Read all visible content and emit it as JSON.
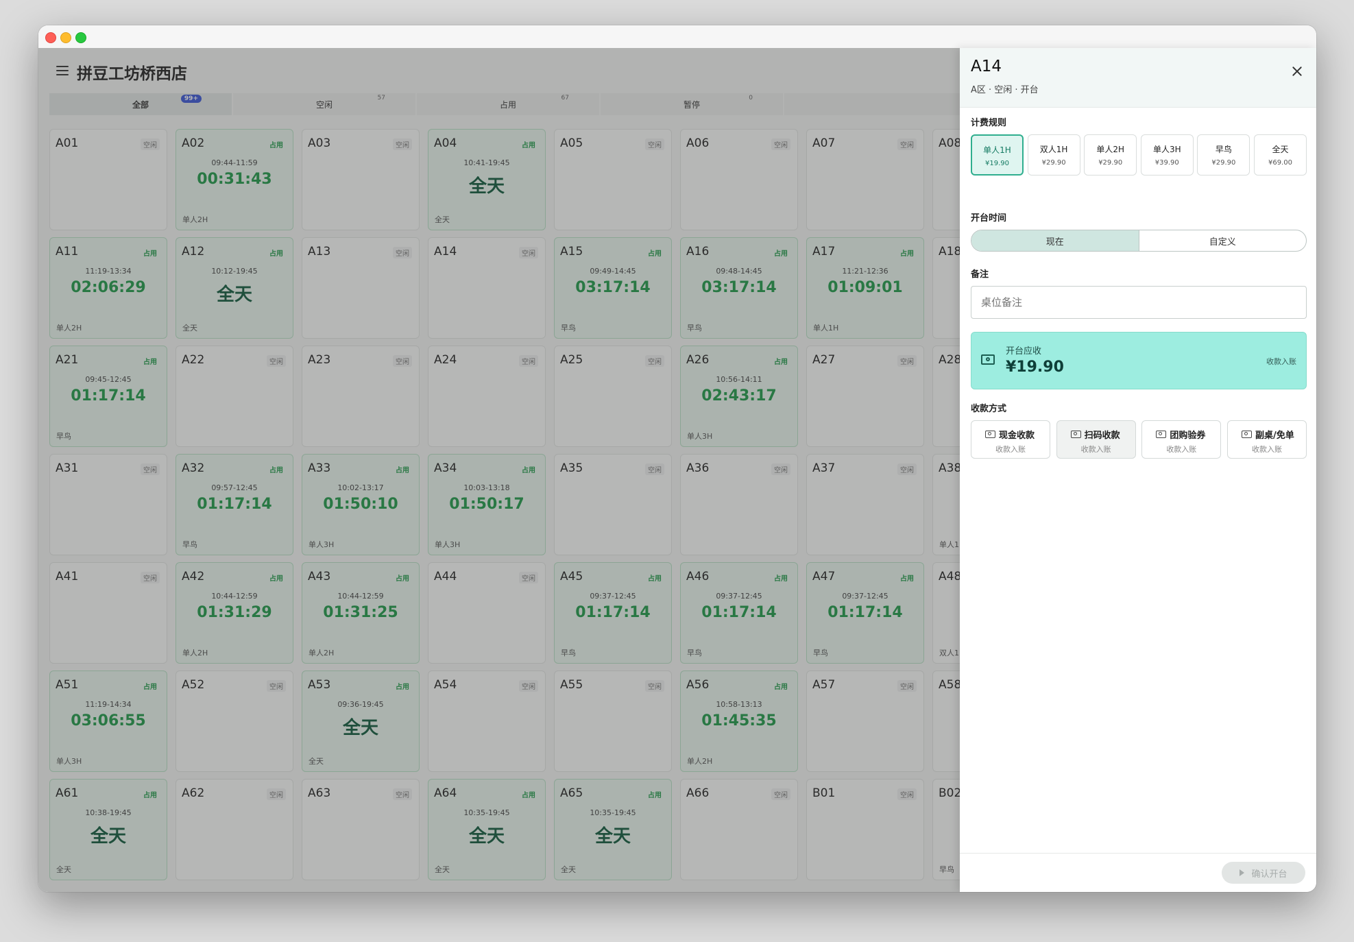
{
  "app": {
    "store_name": "拼豆工坊桥西店",
    "tabs": [
      {
        "label": "全部",
        "badge": "99+"
      },
      {
        "label": "空闲",
        "badge": "57"
      },
      {
        "label": "占用",
        "badge": "67"
      },
      {
        "label": "暂停",
        "badge": "0"
      },
      {
        "label": "",
        "badge": ""
      }
    ]
  },
  "tables": [
    {
      "name": "A01",
      "status": "空闲"
    },
    {
      "name": "A02",
      "status": "占用",
      "time": "09:44-11:59",
      "duration": "00:31:43",
      "rule": "单人2H"
    },
    {
      "name": "A03",
      "status": "空闲"
    },
    {
      "name": "A04",
      "status": "占用",
      "time": "10:41-19:45",
      "duration": "全天",
      "rule": "全天"
    },
    {
      "name": "A05",
      "status": "空闲"
    },
    {
      "name": "A06",
      "status": "空闲"
    },
    {
      "name": "A07",
      "status": "空闲"
    },
    {
      "name": "A08",
      "status": ""
    },
    {
      "name": "A11",
      "status": "占用",
      "time": "11:19-13:34",
      "duration": "02:06:29",
      "rule": "单人2H"
    },
    {
      "name": "A12",
      "status": "占用",
      "time": "10:12-19:45",
      "duration": "全天",
      "rule": "全天"
    },
    {
      "name": "A13",
      "status": "空闲"
    },
    {
      "name": "A14",
      "status": "空闲"
    },
    {
      "name": "A15",
      "status": "占用",
      "time": "09:49-14:45",
      "duration": "03:17:14",
      "rule": "早鸟"
    },
    {
      "name": "A16",
      "status": "占用",
      "time": "09:48-14:45",
      "duration": "03:17:14",
      "rule": "早鸟"
    },
    {
      "name": "A17",
      "status": "占用",
      "time": "11:21-12:36",
      "duration": "01:09:01",
      "rule": "单人1H"
    },
    {
      "name": "A18",
      "status": ""
    },
    {
      "name": "A21",
      "status": "占用",
      "time": "09:45-12:45",
      "duration": "01:17:14",
      "rule": "早鸟"
    },
    {
      "name": "A22",
      "status": "空闲"
    },
    {
      "name": "A23",
      "status": "空闲"
    },
    {
      "name": "A24",
      "status": "空闲"
    },
    {
      "name": "A25",
      "status": "空闲"
    },
    {
      "name": "A26",
      "status": "占用",
      "time": "10:56-14:11",
      "duration": "02:43:17",
      "rule": "单人3H"
    },
    {
      "name": "A27",
      "status": "空闲"
    },
    {
      "name": "A28",
      "status": ""
    },
    {
      "name": "A31",
      "status": "空闲"
    },
    {
      "name": "A32",
      "status": "占用",
      "time": "09:57-12:45",
      "duration": "01:17:14",
      "rule": "早鸟"
    },
    {
      "name": "A33",
      "status": "占用",
      "time": "10:02-13:17",
      "duration": "01:50:10",
      "rule": "单人3H"
    },
    {
      "name": "A34",
      "status": "占用",
      "time": "10:03-13:18",
      "duration": "01:50:17",
      "rule": "单人3H"
    },
    {
      "name": "A35",
      "status": "空闲"
    },
    {
      "name": "A36",
      "status": "空闲"
    },
    {
      "name": "A37",
      "status": "空闲"
    },
    {
      "name": "A38",
      "status": "",
      "rule": "单人1"
    },
    {
      "name": "A41",
      "status": "空闲"
    },
    {
      "name": "A42",
      "status": "占用",
      "time": "10:44-12:59",
      "duration": "01:31:29",
      "rule": "单人2H"
    },
    {
      "name": "A43",
      "status": "占用",
      "time": "10:44-12:59",
      "duration": "01:31:25",
      "rule": "单人2H"
    },
    {
      "name": "A44",
      "status": "空闲"
    },
    {
      "name": "A45",
      "status": "占用",
      "time": "09:37-12:45",
      "duration": "01:17:14",
      "rule": "早鸟"
    },
    {
      "name": "A46",
      "status": "占用",
      "time": "09:37-12:45",
      "duration": "01:17:14",
      "rule": "早鸟"
    },
    {
      "name": "A47",
      "status": "占用",
      "time": "09:37-12:45",
      "duration": "01:17:14",
      "rule": "早鸟"
    },
    {
      "name": "A48",
      "status": "",
      "rule": "双人1"
    },
    {
      "name": "A51",
      "status": "占用",
      "time": "11:19-14:34",
      "duration": "03:06:55",
      "rule": "单人3H"
    },
    {
      "name": "A52",
      "status": "空闲"
    },
    {
      "name": "A53",
      "status": "占用",
      "time": "09:36-19:45",
      "duration": "全天",
      "rule": "全天"
    },
    {
      "name": "A54",
      "status": "空闲"
    },
    {
      "name": "A55",
      "status": "空闲"
    },
    {
      "name": "A56",
      "status": "占用",
      "time": "10:58-13:13",
      "duration": "01:45:35",
      "rule": "单人2H"
    },
    {
      "name": "A57",
      "status": "空闲"
    },
    {
      "name": "A58",
      "status": ""
    },
    {
      "name": "A61",
      "status": "占用",
      "time": "10:38-19:45",
      "duration": "全天",
      "rule": "全天"
    },
    {
      "name": "A62",
      "status": "空闲"
    },
    {
      "name": "A63",
      "status": "空闲"
    },
    {
      "name": "A64",
      "status": "占用",
      "time": "10:35-19:45",
      "duration": "全天",
      "rule": "全天"
    },
    {
      "name": "A65",
      "status": "占用",
      "time": "10:35-19:45",
      "duration": "全天",
      "rule": "全天"
    },
    {
      "name": "A66",
      "status": "空闲"
    },
    {
      "name": "B01",
      "status": "空闲"
    },
    {
      "name": "B02",
      "status": "",
      "rule": "早鸟"
    }
  ],
  "panel": {
    "title": "A14",
    "subtitle": "A区 · 空闲 · 开台",
    "billing_label": "计费规则",
    "rules": [
      {
        "name": "单人1H",
        "price": "¥19.90",
        "selected": true
      },
      {
        "name": "双人1H",
        "price": "¥29.90"
      },
      {
        "name": "单人2H",
        "price": "¥29.90"
      },
      {
        "name": "单人3H",
        "price": "¥39.90"
      },
      {
        "name": "早鸟",
        "price": "¥29.90"
      },
      {
        "name": "全天",
        "price": "¥69.00"
      }
    ],
    "open_time_label": "开台时间",
    "open_time_now": "现在",
    "open_time_custom": "自定义",
    "remark_label": "备注",
    "remark_placeholder": "桌位备注",
    "due_label": "开台应收",
    "due_amount": "¥19.90",
    "due_hint": "收款入账",
    "payment_label": "收款方式",
    "payments": [
      {
        "name": "现金收款",
        "hint": "收款入账"
      },
      {
        "name": "扫码收款",
        "hint": "收款入账"
      },
      {
        "name": "团购验券",
        "hint": "收款入账"
      },
      {
        "name": "副桌/免单",
        "hint": "收款入账"
      }
    ],
    "confirm_label": "确认开台"
  }
}
